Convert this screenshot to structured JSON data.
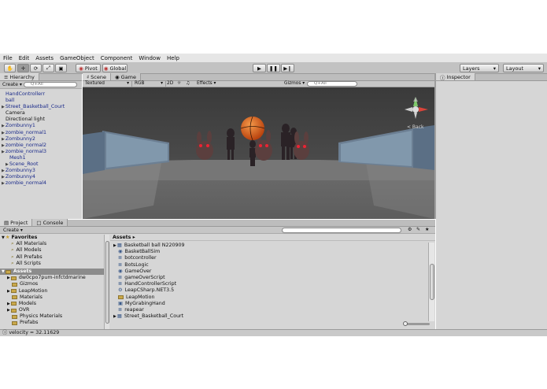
{
  "menu": [
    "File",
    "Edit",
    "Assets",
    "GameObject",
    "Component",
    "Window",
    "Help"
  ],
  "toolbar": {
    "pivot": "Pivot",
    "global": "Global",
    "layers": "Layers",
    "layout": "Layout"
  },
  "hierarchy": {
    "tab": "Hierarchy",
    "create": "Create",
    "search_placeholder": "Q+All",
    "items": [
      {
        "label": "HandControllerr",
        "indent": 1,
        "arrow": false,
        "color": "blue"
      },
      {
        "label": "ball",
        "indent": 1,
        "arrow": false,
        "color": "blue"
      },
      {
        "label": "Street_Basketball_Court",
        "indent": 0,
        "arrow": true,
        "color": "blue"
      },
      {
        "label": "Camera",
        "indent": 1,
        "arrow": false,
        "color": "black"
      },
      {
        "label": "Directional light",
        "indent": 1,
        "arrow": false,
        "color": "black"
      },
      {
        "label": "Zombunny1",
        "indent": 0,
        "arrow": true,
        "color": "blue"
      },
      {
        "label": "zombie_normal1",
        "indent": 0,
        "arrow": true,
        "color": "blue"
      },
      {
        "label": "Zombunny2",
        "indent": 0,
        "arrow": true,
        "color": "blue"
      },
      {
        "label": "zombie_normal2",
        "indent": 0,
        "arrow": true,
        "color": "blue"
      },
      {
        "label": "zombie_normal3",
        "indent": 0,
        "arrow": true,
        "color": "blue"
      },
      {
        "label": "Mesh1",
        "indent": 2,
        "arrow": false,
        "color": "blue"
      },
      {
        "label": "Scene_Root",
        "indent": 1,
        "arrow": true,
        "color": "blue"
      },
      {
        "label": "Zombunny3",
        "indent": 0,
        "arrow": true,
        "color": "blue"
      },
      {
        "label": "Zombunny4",
        "indent": 0,
        "arrow": true,
        "color": "blue"
      },
      {
        "label": "zombie_normal4",
        "indent": 0,
        "arrow": true,
        "color": "blue"
      }
    ]
  },
  "scene": {
    "tab_scene": "Scene",
    "tab_game": "Game",
    "textured": "Textured",
    "rgb": "RGB",
    "two_d": "2D",
    "effects": "Effects",
    "gizmos": "Gizmos",
    "search_placeholder": "Q+All",
    "back_label": "< Back"
  },
  "inspector": {
    "tab": "Inspector"
  },
  "project": {
    "tab_project": "Project",
    "tab_console": "Console",
    "create": "Create",
    "favorites_title": "Favorites",
    "favorites": [
      "All Materials",
      "All Models",
      "All Prefabs",
      "All Scripts"
    ],
    "assets_title": "Assets",
    "asset_folders": [
      {
        "label": "dw0cpo7pum-infctdmarine",
        "arrow": true
      },
      {
        "label": "Gizmos",
        "arrow": false
      },
      {
        "label": "LeapMotion",
        "arrow": true
      },
      {
        "label": "Materials",
        "arrow": false
      },
      {
        "label": "Models",
        "arrow": true
      },
      {
        "label": "OVR",
        "arrow": true
      },
      {
        "label": "Physics Materials",
        "arrow": false
      },
      {
        "label": "Prefabs",
        "arrow": false
      }
    ],
    "breadcrumb": "Assets",
    "files": [
      {
        "label": "Basketball ball N220909",
        "arrow": true,
        "icon": "model"
      },
      {
        "label": "BasketBallSim",
        "arrow": false,
        "icon": "unity"
      },
      {
        "label": "botcontroller",
        "arrow": false,
        "icon": "script"
      },
      {
        "label": "BotsLogic",
        "arrow": false,
        "icon": "script"
      },
      {
        "label": "GameOver",
        "arrow": false,
        "icon": "unity"
      },
      {
        "label": "gameOverScript",
        "arrow": false,
        "icon": "script"
      },
      {
        "label": "HandControllerScript",
        "arrow": false,
        "icon": "script"
      },
      {
        "label": "LeapCSharp.NET3.5",
        "arrow": false,
        "icon": "dll"
      },
      {
        "label": "LeapMotion",
        "arrow": false,
        "icon": "folder"
      },
      {
        "label": "MyGrabingHand",
        "arrow": false,
        "icon": "prefab"
      },
      {
        "label": "reapear",
        "arrow": false,
        "icon": "script"
      },
      {
        "label": "Street_Basketball_Court",
        "arrow": true,
        "icon": "model"
      }
    ]
  },
  "status": {
    "text": "velocity = 32.11629"
  },
  "colors": {
    "toolbar_bg": "#c2c2c2",
    "panel_bg": "#d6d6d6",
    "hierarchy_item": "#1a2a8a",
    "selected": "#8c8c8c",
    "ball": "#e2621c"
  }
}
